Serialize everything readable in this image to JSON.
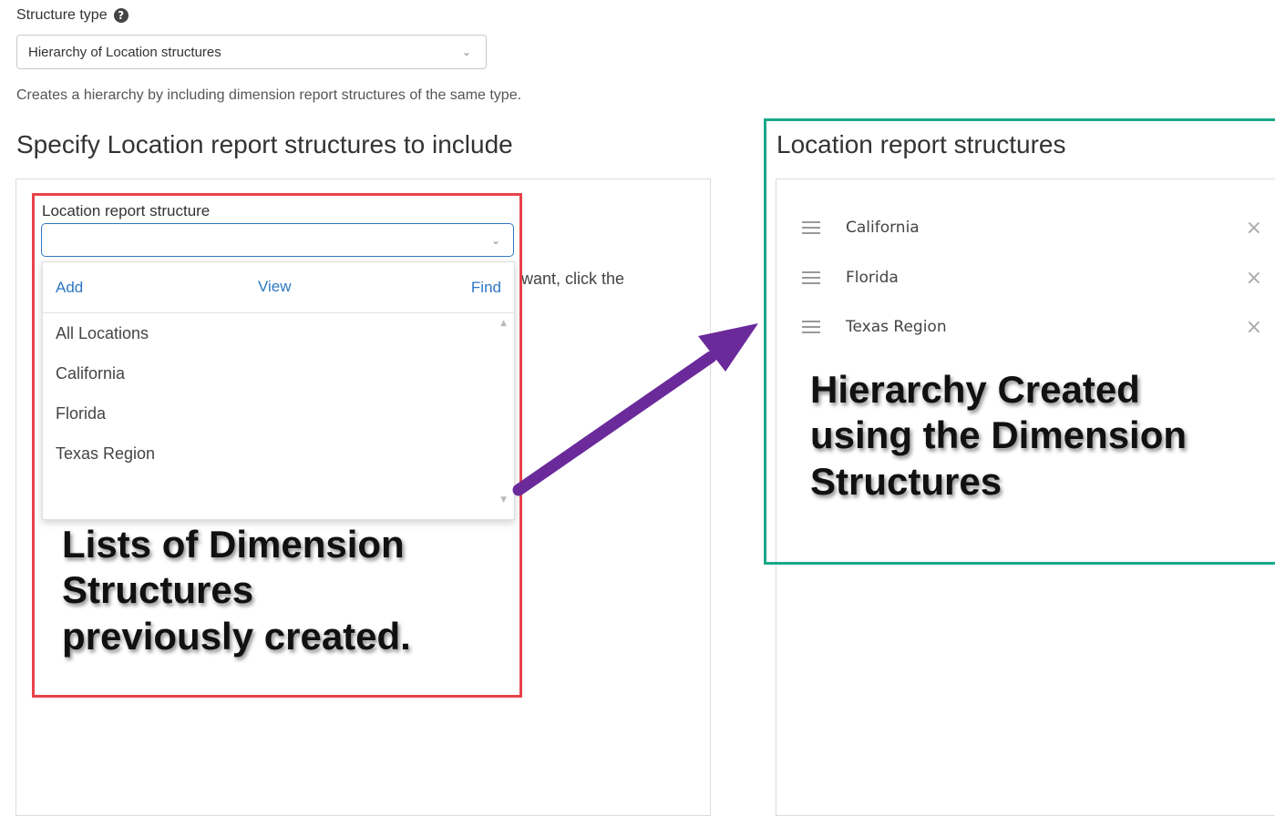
{
  "structure_type": {
    "label": "Structure type",
    "selected_value": "Hierarchy of Location structures",
    "description": "Creates a hierarchy by including dimension report structures of the same type."
  },
  "include_section": {
    "heading": "Specify Location report structures to include",
    "field_label": "Location report structure",
    "input_value": "",
    "partial_help_text": "want, click the",
    "dropdown": {
      "actions": [
        "Add",
        "View",
        "Find"
      ],
      "options": [
        "All Locations",
        "California",
        "Florida",
        "Texas Region"
      ]
    }
  },
  "result_section": {
    "heading": "Location report structures",
    "items": [
      "California",
      "Florida",
      "Texas Region"
    ]
  },
  "annotations": {
    "left_callout": [
      "Lists of Dimension",
      "Structures",
      "previously created."
    ],
    "right_callout": [
      "Hierarchy Created",
      "using the Dimension",
      "Structures"
    ]
  },
  "colors": {
    "accent_blue": "#2e78c4",
    "red_box": "#e8424a",
    "green_box": "#1aa889",
    "arrow": "#6a2a9a"
  },
  "icons": {
    "help": "question-circle-icon",
    "chevron": "chevron-down-icon",
    "drag": "drag-handle-icon",
    "remove": "close-icon"
  }
}
